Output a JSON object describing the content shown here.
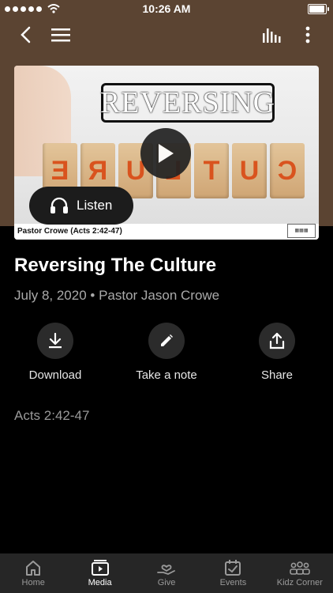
{
  "status": {
    "time": "10:26 AM"
  },
  "hero": {
    "word": "REVERSING",
    "blocks": [
      "E",
      "R",
      "U",
      "L",
      "T",
      "U",
      "C"
    ],
    "caption": "Pastor Crowe (Acts 2:42-47)",
    "listen_label": "Listen"
  },
  "sermon": {
    "title": "Reversing The Culture",
    "meta": "July 8, 2020 • Pastor Jason Crowe",
    "scripture": "Acts 2:42-47"
  },
  "actions": {
    "download": "Download",
    "note": "Take a note",
    "share": "Share"
  },
  "tabs": {
    "home": "Home",
    "media": "Media",
    "give": "Give",
    "events": "Events",
    "kidz": "Kidz Corner"
  },
  "colors": {
    "header": "#5b4432",
    "accent_block": "#d9531e"
  }
}
